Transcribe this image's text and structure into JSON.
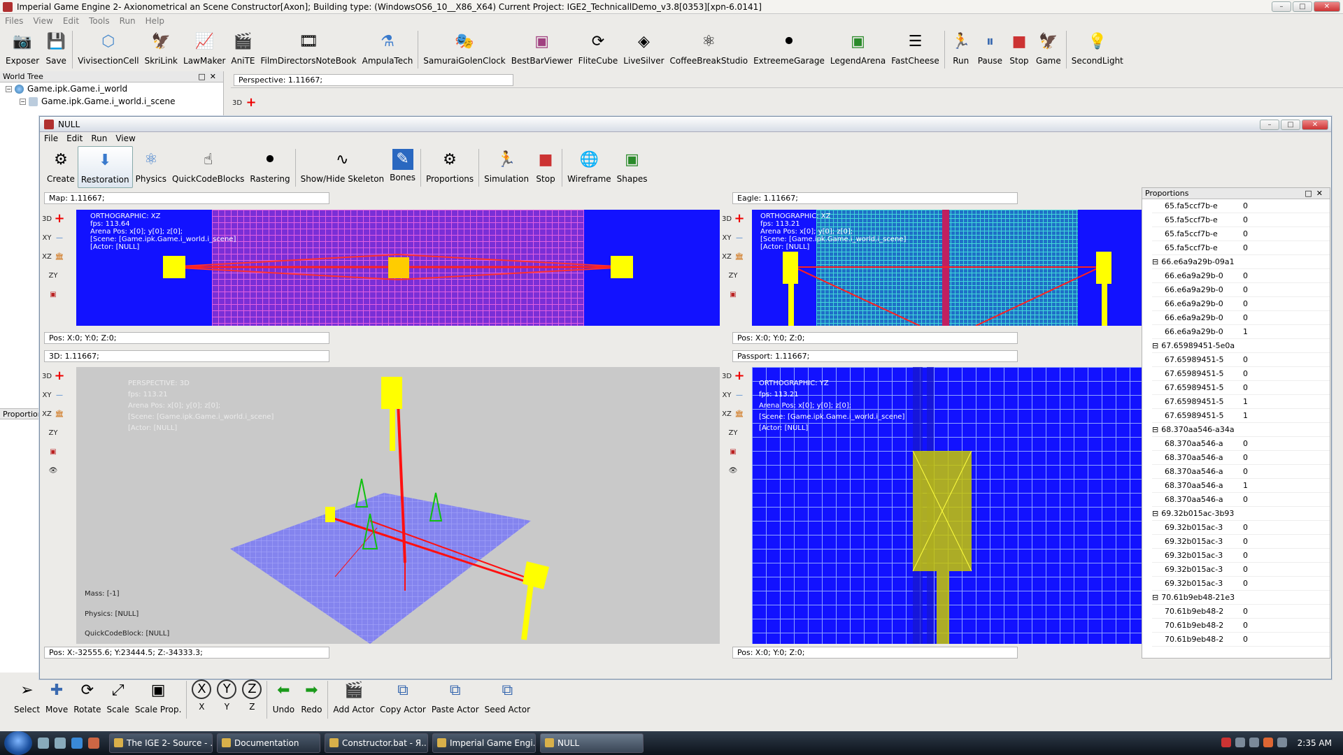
{
  "window": {
    "title": "Imperial Game Engine 2- Axionometrical an Scene Constructor[Axon]; Building type: (WindowsOS6_10__X86_X64) Current Project: IGE2_TechnicallDemo_v3.8[0353][xpn-6.0141]",
    "menu": [
      "Files",
      "View",
      "Edit",
      "Tools",
      "Run",
      "Help"
    ]
  },
  "main_toolbar": {
    "groups": [
      [
        "Exposer",
        "Save"
      ],
      [
        "VivisectionCell",
        "SkriLink",
        "LawMaker",
        "AniTE",
        "FilmDirectorsNoteBook",
        "AmpulaTech"
      ],
      [
        "SamuraiGolenClock",
        "BestBarViewer",
        "FliteCube",
        "LiveSilver",
        "CoffeeBreakStudio",
        "ExtreemeGarage",
        "LegendArena",
        "FastCheese"
      ],
      [
        "Run",
        "Pause",
        "Stop",
        "Game"
      ],
      [
        "SecondLight"
      ]
    ]
  },
  "world_tree": {
    "header": "World Tree",
    "nodes": [
      "Game.ipk.Game.i_world",
      "Game.ipk.Game.i_world.i_scene"
    ],
    "proportions_tab": "Proportion"
  },
  "perspective_strip": {
    "label": "Perspective: 1.11667;",
    "btn_3d": "3D"
  },
  "null_window": {
    "title": "NULL",
    "menu": [
      "File",
      "Edit",
      "Run",
      "View"
    ],
    "toolbar": {
      "groups": [
        [
          "Create",
          "Restoration",
          "Physics",
          "QuickCodeBlocks",
          "Rastering"
        ],
        [
          "Show/Hide Skeleton",
          "Bones"
        ],
        [
          "Proportions"
        ],
        [
          "Simulation",
          "Stop"
        ],
        [
          "Wireframe",
          "Shapes"
        ]
      ],
      "active": "Restoration"
    }
  },
  "view_buttons": [
    "3D",
    "XY",
    "XZ",
    "ZY"
  ],
  "viewports": {
    "map": {
      "label": "Map: 1.11667;",
      "info": "ORTHOGRAPHIC: XZ\nfps: 113.64\nArena Pos: x[0]; y[0]; z[0];\n[Scene: [Game.ipk.Game.i_world.i_scene]\n[Actor: [NULL]",
      "pos": "Pos:  X:0; Y:0; Z:0;"
    },
    "eagle": {
      "label": "Eagle: 1.11667;",
      "info": "ORTHOGRAPHIC: XZ\nfps: 113.21\nArena Pos: x[0]; y[0]; z[0];\n[Scene: [Game.ipk.Game.i_world.i_scene]\n[Actor: [NULL]",
      "pos": "Pos:  X:0; Y:0; Z:0;"
    },
    "threed": {
      "label": "3D: 1.11667;",
      "info": "PERSPECTIVE: 3D\n\nfps: 113.21\n\nArena Pos: x[0]; y[0]; z[0];\n\n[Scene: [Game.ipk.Game.i_world.i_scene]\n\n[Actor: [NULL]",
      "bottom_info": "Mass: [-1]\n\n\nPhysics: [NULL]\n\n\nQuickCodeBlock: [NULL]",
      "pos": "Pos:  X:-32555.6; Y:23444.5; Z:-34333.3;"
    },
    "passport": {
      "label": "Passport: 1.11667;",
      "info": "ORTHOGRAPHIC: YZ\n\nfps: 113.21\n\nArena Pos: x[0]; y[0]; z[0];\n\n[Scene: [Game.ipk.Game.i_world.i_scene]\n\n[Actor: [NULL]",
      "pos": "Pos:  X:0; Y:0; Z:0;"
    }
  },
  "proportions": {
    "header": "Proportions",
    "rows": [
      {
        "key": "65.fa5ccf7b-e",
        "val": "0"
      },
      {
        "key": "65.fa5ccf7b-e",
        "val": "0"
      },
      {
        "key": "65.fa5ccf7b-e",
        "val": "0"
      },
      {
        "key": "65.fa5ccf7b-e",
        "val": "0"
      },
      {
        "key": "66.e6a9a29b-09a1",
        "group": true
      },
      {
        "key": "66.e6a9a29b-0",
        "val": "0"
      },
      {
        "key": "66.e6a9a29b-0",
        "val": "0"
      },
      {
        "key": "66.e6a9a29b-0",
        "val": "0"
      },
      {
        "key": "66.e6a9a29b-0",
        "val": "0"
      },
      {
        "key": "66.e6a9a29b-0",
        "val": "1"
      },
      {
        "key": "67.65989451-5e0a",
        "group": true
      },
      {
        "key": "67.65989451-5",
        "val": "0"
      },
      {
        "key": "67.65989451-5",
        "val": "0"
      },
      {
        "key": "67.65989451-5",
        "val": "0"
      },
      {
        "key": "67.65989451-5",
        "val": "1"
      },
      {
        "key": "67.65989451-5",
        "val": "1"
      },
      {
        "key": "68.370aa546-a34a",
        "group": true
      },
      {
        "key": "68.370aa546-a",
        "val": "0"
      },
      {
        "key": "68.370aa546-a",
        "val": "0"
      },
      {
        "key": "68.370aa546-a",
        "val": "0"
      },
      {
        "key": "68.370aa546-a",
        "val": "1"
      },
      {
        "key": "68.370aa546-a",
        "val": "0"
      },
      {
        "key": "69.32b015ac-3b93",
        "group": true
      },
      {
        "key": "69.32b015ac-3",
        "val": "0"
      },
      {
        "key": "69.32b015ac-3",
        "val": "0"
      },
      {
        "key": "69.32b015ac-3",
        "val": "0"
      },
      {
        "key": "69.32b015ac-3",
        "val": "0"
      },
      {
        "key": "69.32b015ac-3",
        "val": "0"
      },
      {
        "key": "70.61b9eb48-21e3",
        "group": true
      },
      {
        "key": "70.61b9eb48-2",
        "val": "0"
      },
      {
        "key": "70.61b9eb48-2",
        "val": "0"
      },
      {
        "key": "70.61b9eb48-2",
        "val": "0"
      }
    ]
  },
  "bottom_toolbar": {
    "groups": [
      [
        "Select",
        "Move",
        "Rotate",
        "Scale",
        "Scale Prop."
      ],
      [
        "X",
        "Y",
        "Z"
      ],
      [
        "Undo",
        "Redo"
      ],
      [
        "Add Actor",
        "Copy Actor",
        "Paste Actor",
        "Seed Actor"
      ]
    ]
  },
  "taskbar": {
    "items": [
      "The IGE 2- Source - ...",
      "Documentation",
      "Constructor.bat - Я...",
      "Imperial Game Engi...",
      "NULL"
    ],
    "clock": "2:35 AM"
  },
  "colors": {
    "viewport_blue": "#1212ff",
    "viewport_grey": "#c9c9c9",
    "actor_yellow": "#ffff00",
    "skeleton_red": "#ff0000"
  }
}
